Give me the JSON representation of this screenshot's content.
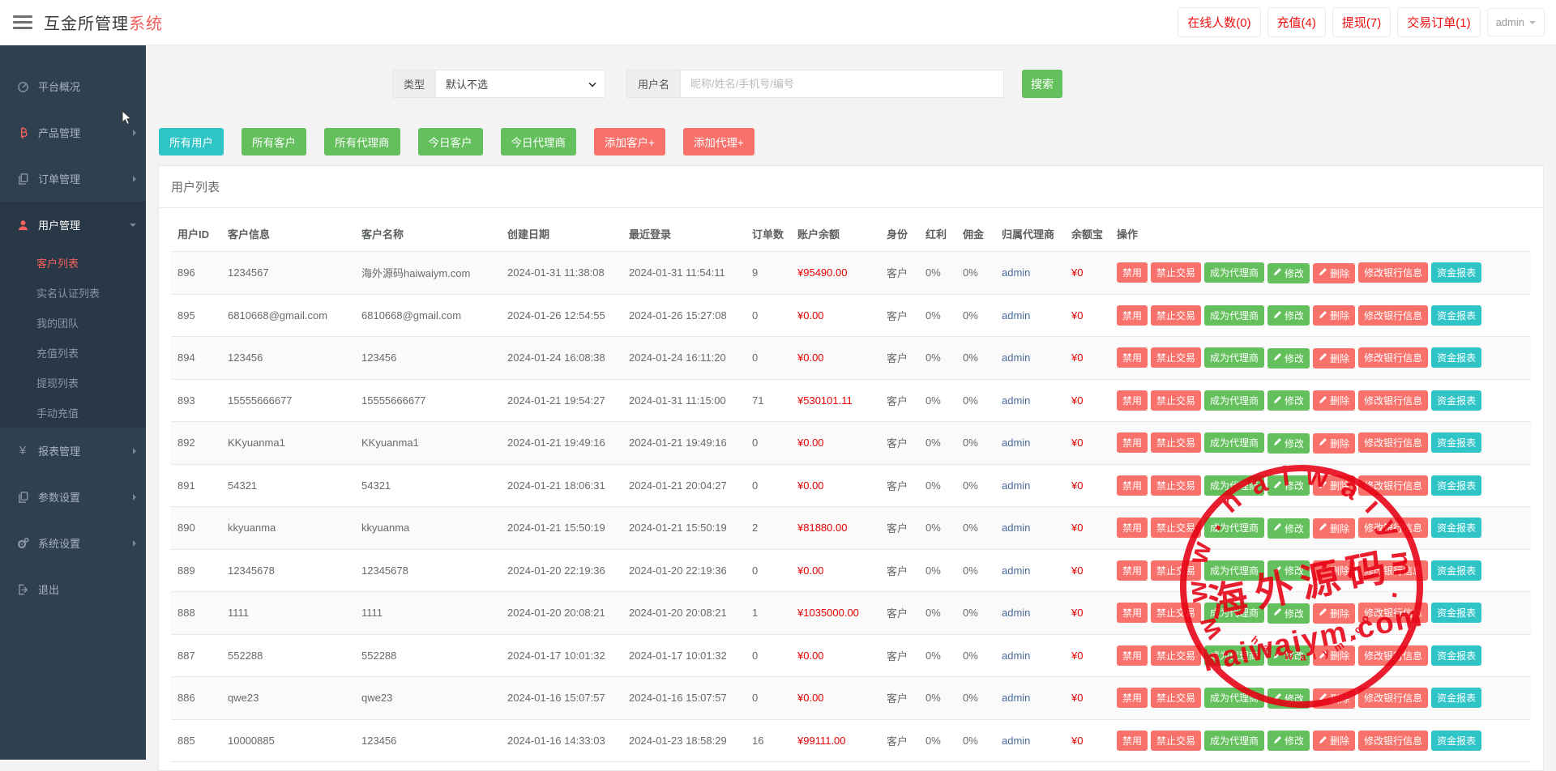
{
  "header": {
    "title_black": "互金所管理",
    "title_red": "系统",
    "right_buttons": [
      {
        "name": "online-count-button",
        "label": "在线人数(0)"
      },
      {
        "name": "deposit-button",
        "label": "充值(4)"
      },
      {
        "name": "withdraw-button",
        "label": "提现(7)"
      },
      {
        "name": "trade-orders-button",
        "label": "交易订单(1)"
      }
    ],
    "user_menu": {
      "label": "admin"
    }
  },
  "sidebar": {
    "items": [
      {
        "name": "overview",
        "label": "平台概况",
        "icon": "dashboard-icon",
        "arrow": "none",
        "active": false
      },
      {
        "name": "products",
        "label": "产品管理",
        "icon": "bitcoin-icon",
        "icon_red": true,
        "arrow": "right",
        "active": false
      },
      {
        "name": "orders",
        "label": "订单管理",
        "icon": "orders-icon",
        "arrow": "right",
        "active": false
      },
      {
        "name": "users",
        "label": "用户管理",
        "icon": "user-icon",
        "icon_red": true,
        "arrow": "down",
        "active": true,
        "children": [
          {
            "name": "customer-list",
            "label": "客户列表",
            "active": true
          },
          {
            "name": "kyc-list",
            "label": "实名认证列表",
            "active": false
          },
          {
            "name": "my-team",
            "label": "我的团队",
            "active": false
          },
          {
            "name": "deposit-list",
            "label": "充值列表",
            "active": false
          },
          {
            "name": "withdraw-list",
            "label": "提现列表",
            "active": false
          },
          {
            "name": "manual-deposit",
            "label": "手动充值",
            "active": false
          }
        ]
      },
      {
        "name": "reports",
        "label": "报表管理",
        "icon": "yen-icon",
        "arrow": "right",
        "active": false
      },
      {
        "name": "params",
        "label": "参数设置",
        "icon": "params-icon",
        "arrow": "right",
        "active": false
      },
      {
        "name": "system",
        "label": "系统设置",
        "icon": "gear-icon",
        "arrow": "right",
        "active": false
      },
      {
        "name": "logout",
        "label": "退出",
        "icon": "logout-icon",
        "arrow": "none",
        "active": false
      }
    ]
  },
  "search": {
    "type_label": "类型",
    "type_value": "默认不选",
    "username_label": "用户名",
    "username_placeholder": "昵称/姓名/手机号/编号",
    "search_button": "搜索"
  },
  "filters": [
    {
      "name": "all-users",
      "label": "所有用户",
      "color": "teal"
    },
    {
      "name": "all-customers",
      "label": "所有客户",
      "color": "green"
    },
    {
      "name": "all-agents",
      "label": "所有代理商",
      "color": "green"
    },
    {
      "name": "today-customers",
      "label": "今日客户",
      "color": "green"
    },
    {
      "name": "today-agents",
      "label": "今日代理商",
      "color": "green"
    },
    {
      "name": "add-customer",
      "label": "添加客户+",
      "color": "red"
    },
    {
      "name": "add-agent",
      "label": "添加代理+",
      "color": "red"
    }
  ],
  "panel": {
    "title": "用户列表"
  },
  "table": {
    "columns": [
      "用户ID",
      "客户信息",
      "客户名称",
      "创建日期",
      "最近登录",
      "订单数",
      "账户余额",
      "身份",
      "红利",
      "佣金",
      "归属代理商",
      "余额宝",
      "操作"
    ],
    "actions": [
      {
        "name": "disable-button",
        "label": "禁用",
        "color": "red",
        "icon": "none"
      },
      {
        "name": "forbid-trade-button",
        "label": "禁止交易",
        "color": "red",
        "icon": "none"
      },
      {
        "name": "make-agent-button",
        "label": "成为代理商",
        "color": "green",
        "icon": "none"
      },
      {
        "name": "edit-button",
        "label": "修改",
        "color": "green",
        "icon": "pencil-icon"
      },
      {
        "name": "delete-button",
        "label": "删除",
        "color": "red",
        "icon": "pencil-icon"
      },
      {
        "name": "edit-bank-button",
        "label": "修改银行信息",
        "color": "red",
        "icon": "none"
      },
      {
        "name": "fund-report-button",
        "label": "资金报表",
        "color": "teal",
        "icon": "none"
      }
    ],
    "rows": [
      {
        "id": "896",
        "info": "1234567",
        "cname": "海外源码haiwaiym.com",
        "created": "2024-01-31 11:38:08",
        "last_login": "2024-01-31 11:54:11",
        "orders": "9",
        "balance": "¥95490.00",
        "role": "客户",
        "bonus": "0%",
        "commission": "0%",
        "agent": "admin",
        "yuebao": "¥0"
      },
      {
        "id": "895",
        "info": "6810668@gmail.com",
        "cname": "6810668@gmail.com",
        "created": "2024-01-26 12:54:55",
        "last_login": "2024-01-26 15:27:08",
        "orders": "0",
        "balance": "¥0.00",
        "role": "客户",
        "bonus": "0%",
        "commission": "0%",
        "agent": "admin",
        "yuebao": "¥0"
      },
      {
        "id": "894",
        "info": "123456",
        "cname": "123456",
        "created": "2024-01-24 16:08:38",
        "last_login": "2024-01-24 16:11:20",
        "orders": "0",
        "balance": "¥0.00",
        "role": "客户",
        "bonus": "0%",
        "commission": "0%",
        "agent": "admin",
        "yuebao": "¥0"
      },
      {
        "id": "893",
        "info": "15555666677",
        "cname": "15555666677",
        "created": "2024-01-21 19:54:27",
        "last_login": "2024-01-31 11:15:00",
        "orders": "71",
        "balance": "¥530101.11",
        "role": "客户",
        "bonus": "0%",
        "commission": "0%",
        "agent": "admin",
        "yuebao": "¥0"
      },
      {
        "id": "892",
        "info": "KKyuanma1",
        "cname": "KKyuanma1",
        "created": "2024-01-21 19:49:16",
        "last_login": "2024-01-21 19:49:16",
        "orders": "0",
        "balance": "¥0.00",
        "role": "客户",
        "bonus": "0%",
        "commission": "0%",
        "agent": "admin",
        "yuebao": "¥0"
      },
      {
        "id": "891",
        "info": "54321",
        "cname": "54321",
        "created": "2024-01-21 18:06:31",
        "last_login": "2024-01-21 20:04:27",
        "orders": "0",
        "balance": "¥0.00",
        "role": "客户",
        "bonus": "0%",
        "commission": "0%",
        "agent": "admin",
        "yuebao": "¥0"
      },
      {
        "id": "890",
        "info": "kkyuanma",
        "cname": "kkyuanma",
        "created": "2024-01-21 15:50:19",
        "last_login": "2024-01-21 15:50:19",
        "orders": "2",
        "balance": "¥81880.00",
        "role": "客户",
        "bonus": "0%",
        "commission": "0%",
        "agent": "admin",
        "yuebao": "¥0"
      },
      {
        "id": "889",
        "info": "12345678",
        "cname": "12345678",
        "created": "2024-01-20 22:19:36",
        "last_login": "2024-01-20 22:19:36",
        "orders": "0",
        "balance": "¥0.00",
        "role": "客户",
        "bonus": "0%",
        "commission": "0%",
        "agent": "admin",
        "yuebao": "¥0"
      },
      {
        "id": "888",
        "info": "1111",
        "cname": "1111",
        "created": "2024-01-20 20:08:21",
        "last_login": "2024-01-20 20:08:21",
        "orders": "1",
        "balance": "¥1035000.00",
        "role": "客户",
        "bonus": "0%",
        "commission": "0%",
        "agent": "admin",
        "yuebao": "¥0"
      },
      {
        "id": "887",
        "info": "552288",
        "cname": "552288",
        "created": "2024-01-17 10:01:32",
        "last_login": "2024-01-17 10:01:32",
        "orders": "0",
        "balance": "¥0.00",
        "role": "客户",
        "bonus": "0%",
        "commission": "0%",
        "agent": "admin",
        "yuebao": "¥0"
      },
      {
        "id": "886",
        "info": "qwe23",
        "cname": "qwe23",
        "created": "2024-01-16 15:07:57",
        "last_login": "2024-01-16 15:07:57",
        "orders": "0",
        "balance": "¥0.00",
        "role": "客户",
        "bonus": "0%",
        "commission": "0%",
        "agent": "admin",
        "yuebao": "¥0"
      },
      {
        "id": "885",
        "info": "10000885",
        "cname": "123456",
        "created": "2024-01-16 14:33:03",
        "last_login": "2024-01-23 18:58:29",
        "orders": "16",
        "balance": "¥99111.00",
        "role": "客户",
        "bonus": "0%",
        "commission": "0%",
        "agent": "admin",
        "yuebao": "¥0"
      }
    ]
  },
  "watermark": {
    "arc_top": "w w w . h a i w a i y m . c o m",
    "center": "海外源码",
    "line2": "haiwaiym.com",
    "arc_bottom": "h a i w a i y m . c o m"
  },
  "colors": {
    "accent_red": "#f4615c",
    "topbar_red": "#f20d0d",
    "button_red": "#f8716b",
    "button_green": "#63c05c",
    "button_teal": "#2fc5c7",
    "money_red": "#e80000",
    "link_blue": "#4a6b9b",
    "sidebar_bg": "#2f4050",
    "sidebar_active_bg": "#293846",
    "stamp_red": "#e60012"
  }
}
